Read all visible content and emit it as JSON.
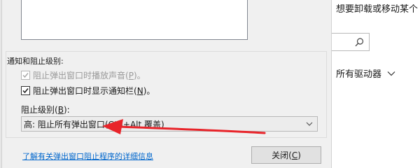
{
  "dialog": {
    "group_label": "通知和阻止级别:",
    "play_sound": {
      "label": "阻止弹出窗口时播放声音",
      "accel": "P",
      "suffix": "。",
      "checked": true,
      "disabled": true
    },
    "show_bar": {
      "label": "阻止弹出窗口时显示通知栏",
      "accel": "N",
      "suffix": "。",
      "checked": true,
      "disabled": false
    },
    "level_label": "阻止级别",
    "level_accel": "B",
    "level_value": "高: 阻止所有弹出窗口(Ctrl+Alt 覆盖)",
    "learn_link": "了解有关弹出窗口阻止程序的详细信息",
    "close_label": "关闭",
    "close_accel": "C"
  },
  "settings_page": {
    "heading": "想要卸载或移动某个",
    "drive_filter": "所有驱动器"
  },
  "icons": {
    "search": "search-icon",
    "dropdown": "chevron-down-icon",
    "check": "check-icon"
  },
  "colors": {
    "annotation_arrow": "#e8242a",
    "link": "#0066cc"
  }
}
